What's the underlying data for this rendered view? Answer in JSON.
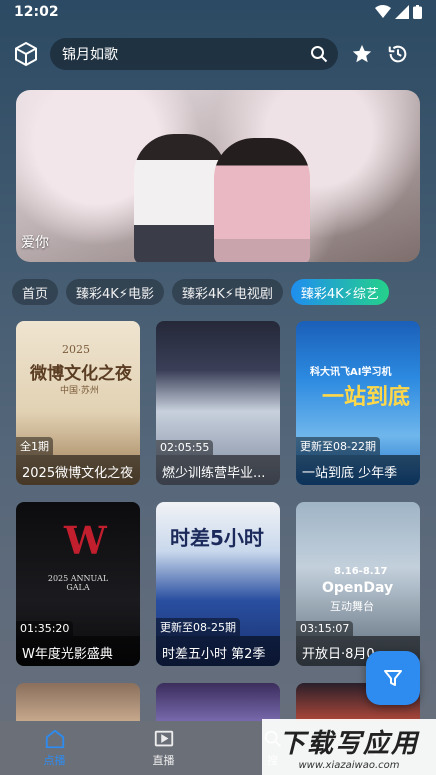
{
  "status": {
    "time": "12:02"
  },
  "search": {
    "value": "锦月如歌"
  },
  "banner": {
    "label": "爱你"
  },
  "tabs": [
    "首页",
    "臻彩4K⚡电影",
    "臻彩4K⚡电视剧",
    "臻彩4K⚡综艺"
  ],
  "cards": [
    {
      "badge": "全1期",
      "title": "2025微博文化之夜",
      "poster_text": "微博文化之夜",
      "poster_year": "2025",
      "poster_sub": "中国·苏州"
    },
    {
      "badge": "02:05:55",
      "title": "燃少训练营毕业..."
    },
    {
      "badge": "更新至08-22期",
      "title": "一站到底 少年季",
      "poster_text": "科大讯飞AI学习机",
      "poster_sub": "一站到底"
    },
    {
      "badge": "01:35:20",
      "title": "W年度光影盛典",
      "poster_text": "W",
      "poster_sub": "2025 ANNUAL GALA"
    },
    {
      "badge": "更新至08-25期",
      "title": "时差五小时 第2季",
      "poster_text": "时差5小时"
    },
    {
      "badge": "03:15:07",
      "title": "开放日·8月0...",
      "poster_text": "8.16-8.17",
      "poster_sub": "OpenDay",
      "poster_sub2": "互动舞台"
    }
  ],
  "nav": [
    {
      "label": "点播",
      "icon": "home-icon"
    },
    {
      "label": "直播",
      "icon": "tv-icon"
    },
    {
      "label": "搜",
      "icon": "search-icon"
    },
    {
      "label": "",
      "icon": "user-icon"
    }
  ],
  "watermark": {
    "big": "下载写应用",
    "small": "www.xiazaiwao.com"
  },
  "colors": {
    "accent": "#2e8bf0",
    "tab_active_start": "#1f8ef0",
    "tab_active_end": "#25d18a"
  }
}
